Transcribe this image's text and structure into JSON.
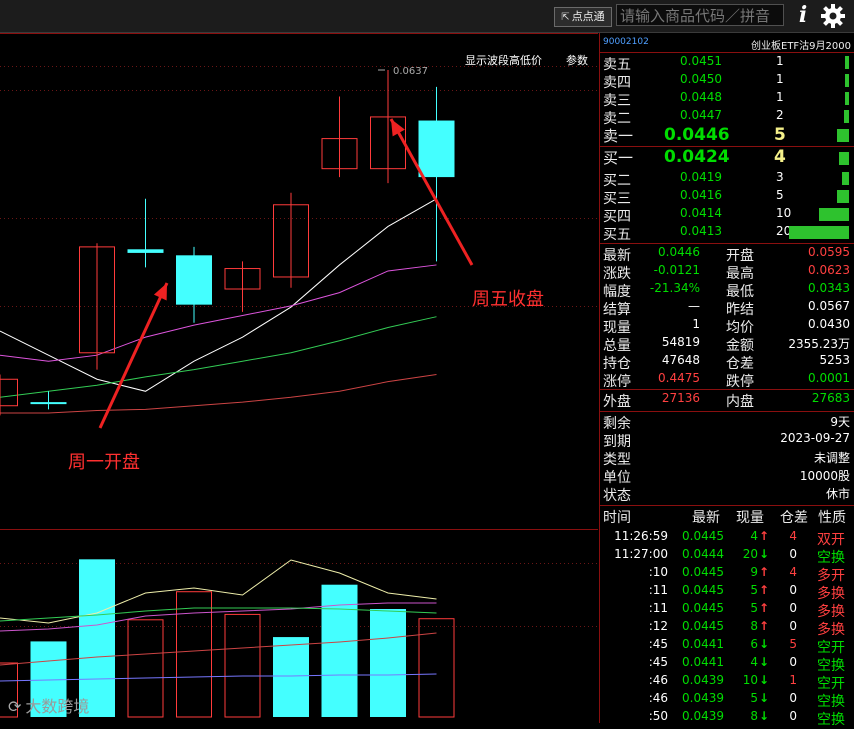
{
  "toolbar": {
    "dots_button": "点点通",
    "search_placeholder": "请输入商品代码／拼音"
  },
  "chart_header": {
    "show_wave_label": "显示波段高低价",
    "params_label": "参数",
    "high_marker": "0.0637"
  },
  "annotations": {
    "monday": "周一开盘",
    "friday": "周五收盘"
  },
  "watermark": "大数跨境",
  "chart_data": {
    "type": "candlestick",
    "candles": [
      {
        "open": 0.0358,
        "close": 0.038,
        "high": 0.0384,
        "low": 0.035
      },
      {
        "open": 0.0361,
        "close": 0.036,
        "high": 0.037,
        "low": 0.0355
      },
      {
        "open": 0.0402,
        "close": 0.049,
        "high": 0.0493,
        "low": 0.0388
      },
      {
        "open": 0.0488,
        "close": 0.0485,
        "high": 0.053,
        "low": 0.0473
      },
      {
        "open": 0.0483,
        "close": 0.0442,
        "high": 0.049,
        "low": 0.0427
      },
      {
        "open": 0.0455,
        "close": 0.0472,
        "high": 0.0478,
        "low": 0.0436
      },
      {
        "open": 0.0465,
        "close": 0.0525,
        "high": 0.0535,
        "low": 0.0456
      },
      {
        "open": 0.0555,
        "close": 0.058,
        "high": 0.0615,
        "low": 0.0548
      },
      {
        "open": 0.0555,
        "close": 0.0598,
        "high": 0.0637,
        "low": 0.0543
      },
      {
        "open": 0.0595,
        "close": 0.0548,
        "high": 0.0623,
        "low": 0.0478
      }
    ],
    "volume": [
      {
        "v": 100,
        "up": false
      },
      {
        "v": 140,
        "up": true
      },
      {
        "v": 292,
        "up": true
      },
      {
        "v": 180,
        "up": false
      },
      {
        "v": 232,
        "up": false
      },
      {
        "v": 190,
        "up": false
      },
      {
        "v": 148,
        "up": true
      },
      {
        "v": 245,
        "up": true
      },
      {
        "v": 200,
        "up": true
      },
      {
        "v": 182,
        "up": false
      }
    ]
  },
  "quote": {
    "code": "90002102",
    "name": "创业板ETF沽9月2000",
    "sell": [
      {
        "label": "卖五",
        "price": "0.0451",
        "qty": "1",
        "bar": 0.04
      },
      {
        "label": "卖四",
        "price": "0.0450",
        "qty": "1",
        "bar": 0.04
      },
      {
        "label": "卖三",
        "price": "0.0448",
        "qty": "1",
        "bar": 0.04
      },
      {
        "label": "卖二",
        "price": "0.0447",
        "qty": "2",
        "bar": 0.08
      },
      {
        "label": "卖一",
        "price": "0.0446",
        "qty": "5",
        "bar": 0.2
      }
    ],
    "buy": [
      {
        "label": "买一",
        "price": "0.0424",
        "qty": "4",
        "bar": 0.16
      },
      {
        "label": "买二",
        "price": "0.0419",
        "qty": "3",
        "bar": 0.12
      },
      {
        "label": "买三",
        "price": "0.0416",
        "qty": "5",
        "bar": 0.2
      },
      {
        "label": "买四",
        "price": "0.0414",
        "qty": "10",
        "bar": 0.5
      },
      {
        "label": "买五",
        "price": "0.0413",
        "qty": "20",
        "bar": 1.0
      }
    ],
    "stats": [
      {
        "l1": "最新",
        "v1": "0.0446",
        "c1": "gv",
        "l2": "开盘",
        "v2": "0.0595",
        "c2": "rv"
      },
      {
        "l1": "涨跌",
        "v1": "-0.0121",
        "c1": "gv",
        "l2": "最高",
        "v2": "0.0623",
        "c2": "rv"
      },
      {
        "l1": "幅度",
        "v1": "-21.34%",
        "c1": "gv",
        "l2": "最低",
        "v2": "0.0343",
        "c2": "gv"
      },
      {
        "l1": "结算",
        "v1": "—",
        "c1": "wv",
        "l2": "昨结",
        "v2": "0.0567",
        "c2": "wv"
      },
      {
        "l1": "现量",
        "v1": "1",
        "c1": "wv",
        "l2": "均价",
        "v2": "0.0430",
        "c2": "wv"
      },
      {
        "l1": "总量",
        "v1": "54819",
        "c1": "wv",
        "l2": "金额",
        "v2": "2355.23万",
        "c2": "wv"
      },
      {
        "l1": "持仓",
        "v1": "47648",
        "c1": "wv",
        "l2": "仓差",
        "v2": "5253",
        "c2": "wv"
      },
      {
        "l1": "涨停",
        "v1": "0.4475",
        "c1": "rv",
        "l2": "跌停",
        "v2": "0.0001",
        "c2": "gv"
      }
    ],
    "outer": {
      "l1": "外盘",
      "v1": "27136",
      "l2": "内盘",
      "v2": "27683"
    },
    "info": [
      {
        "label": "剩余",
        "value": "9天"
      },
      {
        "label": "到期",
        "value": "2023-09-27"
      },
      {
        "label": "类型",
        "value": "未调整"
      },
      {
        "label": "单位",
        "value": "10000股"
      },
      {
        "label": "状态",
        "value": "休市"
      }
    ],
    "trades_header": {
      "time": "时间",
      "price": "最新",
      "qty": "现量",
      "oi": "仓差",
      "nature": "性质"
    },
    "trades": [
      {
        "time": "11:26:59",
        "price": "0.0445",
        "qty": "4",
        "dir": "↑",
        "oi": "4",
        "nature": "双开",
        "nc": "rv"
      },
      {
        "time": "11:27:00",
        "price": "0.0444",
        "qty": "20",
        "dir": "↓",
        "oi": "0",
        "nature": "空换",
        "nc": "gv"
      },
      {
        "time": ":10",
        "price": "0.0445",
        "qty": "9",
        "dir": "↑",
        "oi": "4",
        "nature": "多开",
        "nc": "rv"
      },
      {
        "time": ":11",
        "price": "0.0445",
        "qty": "5",
        "dir": "↑",
        "oi": "0",
        "nature": "多换",
        "nc": "rv"
      },
      {
        "time": ":11",
        "price": "0.0445",
        "qty": "5",
        "dir": "↑",
        "oi": "0",
        "nature": "多换",
        "nc": "rv"
      },
      {
        "time": ":12",
        "price": "0.0445",
        "qty": "8",
        "dir": "↑",
        "oi": "0",
        "nature": "多换",
        "nc": "rv"
      },
      {
        "time": ":45",
        "price": "0.0441",
        "qty": "6",
        "dir": "↓",
        "oi": "5",
        "nature": "空开",
        "nc": "gv"
      },
      {
        "time": ":45",
        "price": "0.0441",
        "qty": "4",
        "dir": "↓",
        "oi": "0",
        "nature": "空换",
        "nc": "gv"
      },
      {
        "time": ":46",
        "price": "0.0439",
        "qty": "10",
        "dir": "↓",
        "oi": "1",
        "nature": "空开",
        "nc": "gv"
      },
      {
        "time": ":46",
        "price": "0.0439",
        "qty": "5",
        "dir": "↓",
        "oi": "0",
        "nature": "空换",
        "nc": "gv"
      },
      {
        "time": ":50",
        "price": "0.0439",
        "qty": "8",
        "dir": "↓",
        "oi": "0",
        "nature": "空换",
        "nc": "gv"
      }
    ]
  }
}
